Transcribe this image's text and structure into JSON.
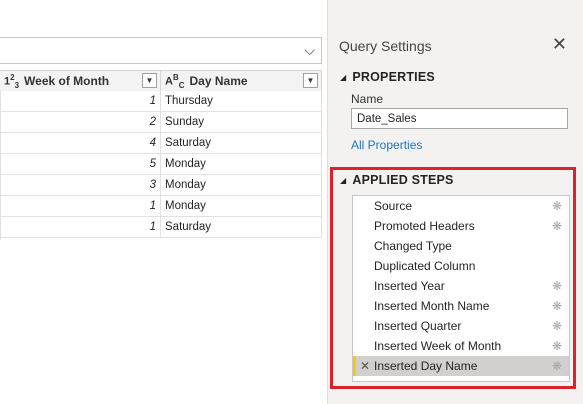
{
  "grid": {
    "columns": [
      {
        "type_icon": "123",
        "title": "Week of Month"
      },
      {
        "type_icon": "ABC",
        "title": "Day Name"
      }
    ],
    "rows": [
      {
        "week": "1",
        "day": "Thursday"
      },
      {
        "week": "2",
        "day": "Sunday"
      },
      {
        "week": "4",
        "day": "Saturday"
      },
      {
        "week": "5",
        "day": "Monday"
      },
      {
        "week": "3",
        "day": "Monday"
      },
      {
        "week": "1",
        "day": "Monday"
      },
      {
        "week": "1",
        "day": "Saturday"
      }
    ]
  },
  "pane": {
    "title": "Query Settings",
    "close_icon": "close-icon",
    "properties": {
      "heading": "PROPERTIES",
      "name_label": "Name",
      "name_value": "Date_Sales",
      "all_properties_link": "All Properties"
    },
    "applied_steps": {
      "heading": "APPLIED STEPS",
      "highlight_color": "#d9232e",
      "steps": [
        {
          "label": "Source",
          "has_gear": true
        },
        {
          "label": "Promoted Headers",
          "has_gear": true
        },
        {
          "label": "Changed Type",
          "has_gear": false
        },
        {
          "label": "Duplicated Column",
          "has_gear": false
        },
        {
          "label": "Inserted Year",
          "has_gear": true
        },
        {
          "label": "Inserted Month Name",
          "has_gear": true
        },
        {
          "label": "Inserted Quarter",
          "has_gear": true
        },
        {
          "label": "Inserted Week of Month",
          "has_gear": true
        },
        {
          "label": "Inserted Day Name",
          "has_gear": true,
          "selected": true
        }
      ]
    }
  }
}
